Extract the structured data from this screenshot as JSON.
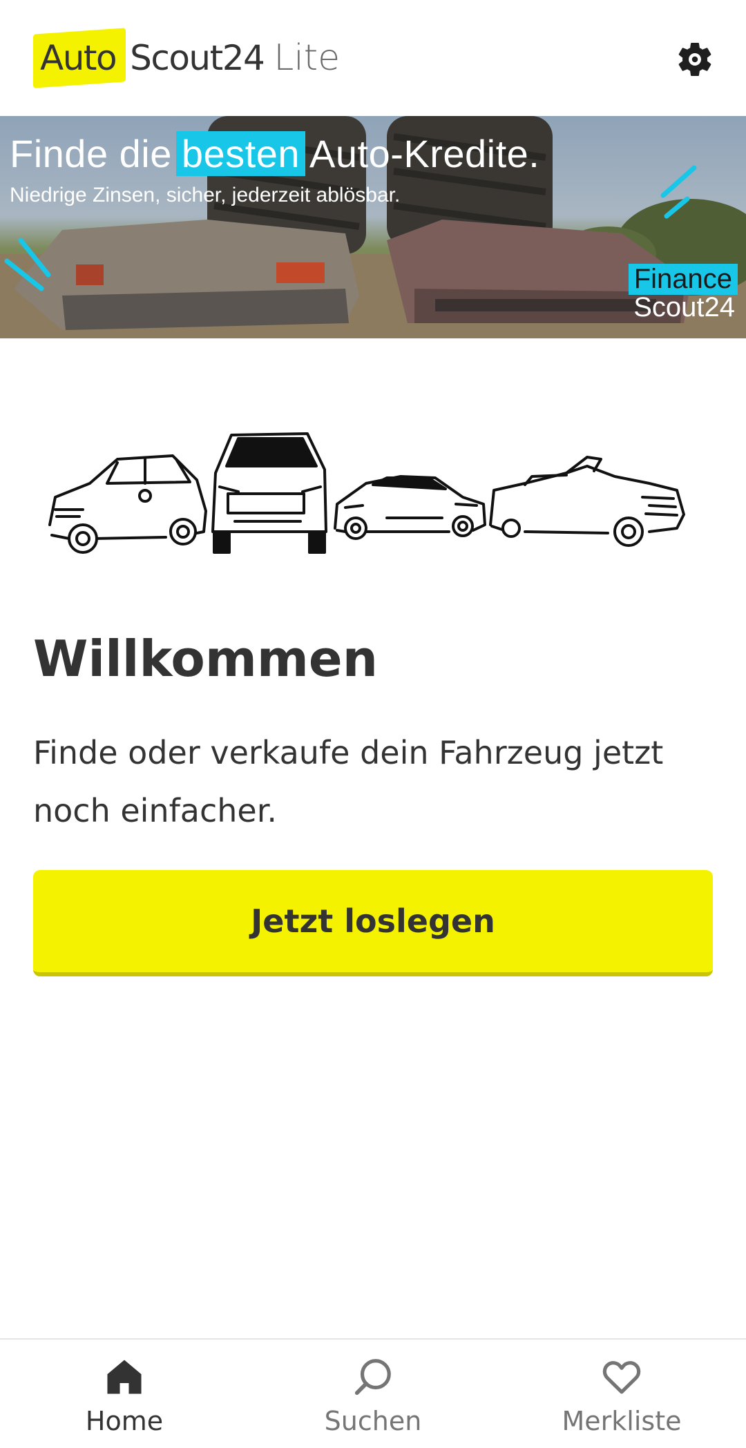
{
  "header": {
    "logo_auto": "Auto",
    "logo_scout": "Scout24",
    "logo_lite": "Lite",
    "settings_icon": "gear-icon"
  },
  "banner": {
    "title_before": "Finde die",
    "title_highlight": "besten",
    "title_after": "Auto-Kredite.",
    "subtitle": "Niedrige Zinsen, sicher, jederzeit ablösbar.",
    "brand_line1": "Finance",
    "brand_line2": "Scout24"
  },
  "main": {
    "title": "Willkommen",
    "description": "Finde oder verkaufe dein Fahrzeug jetzt noch einfacher.",
    "cta_label": "Jetzt loslegen"
  },
  "bottom_nav": {
    "items": [
      {
        "label": "Home",
        "icon": "home-icon",
        "active": true
      },
      {
        "label": "Suchen",
        "icon": "search-icon",
        "active": false
      },
      {
        "label": "Merkliste",
        "icon": "heart-icon",
        "active": false
      }
    ]
  },
  "colors": {
    "brand_yellow": "#f5f200",
    "finance_cyan": "#18c6e8",
    "text_dark": "#333333",
    "text_muted": "#757575"
  }
}
